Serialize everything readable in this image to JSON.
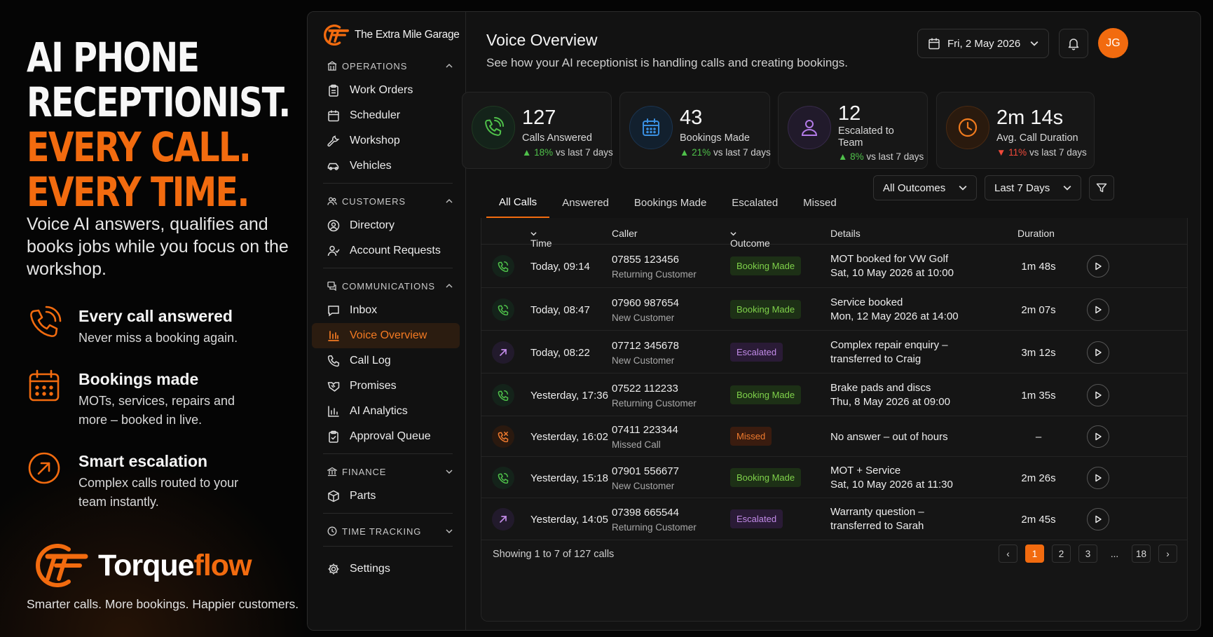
{
  "promo": {
    "headline": [
      "AI PHONE",
      "RECEPTIONIST.",
      "EVERY CALL.",
      "EVERY TIME."
    ],
    "subtitle": "Voice AI answers, qualifies and books jobs while you focus on the workshop.",
    "features": [
      {
        "icon": "phone-ringing-icon",
        "title": "Every call answered",
        "desc": "Never miss a booking again."
      },
      {
        "icon": "calendar-icon",
        "title": "Bookings made",
        "desc": "MOTs, services, repairs and more – booked in live."
      },
      {
        "icon": "arrow-up-right-circle-icon",
        "title": "Smart escalation",
        "desc": "Complex calls routed to your team instantly."
      }
    ],
    "brand_part1": "Torque",
    "brand_part2": "flow",
    "tagline": "Smarter calls. More bookings. Happier customers."
  },
  "app": {
    "garage_name": "The Extra Mile Garage",
    "sections": {
      "operations": "OPERATIONS",
      "customers": "CUSTOMERS",
      "communications": "COMMUNICATIONS",
      "finance": "FINANCE",
      "time_tracking": "TIME TRACKING"
    },
    "nav": {
      "work_orders": "Work Orders",
      "scheduler": "Scheduler",
      "workshop": "Workshop",
      "vehicles": "Vehicles",
      "directory": "Directory",
      "account_requests": "Account Requests",
      "inbox": "Inbox",
      "voice_overview": "Voice Overview",
      "call_log": "Call Log",
      "promises": "Promises",
      "ai_analytics": "AI Analytics",
      "approval_queue": "Approval Queue",
      "parts": "Parts",
      "settings": "Settings"
    },
    "header": {
      "title": "Voice Overview",
      "subtitle": "See how your AI receptionist is handling calls and creating bookings.",
      "date": "Fri, 2 May 2026",
      "avatar_initials": "JG"
    },
    "stats": [
      {
        "value": "127",
        "label": "Calls Answered",
        "trend": "18%",
        "trend_dir": "up",
        "trend_suffix": "vs last 7 days",
        "color": "#4fc14a"
      },
      {
        "value": "43",
        "label": "Bookings Made",
        "trend": "21%",
        "trend_dir": "up",
        "trend_suffix": "vs last 7 days",
        "color": "#3a8fe0"
      },
      {
        "value": "12",
        "label": "Escalated to Team",
        "trend": "8%",
        "trend_dir": "up",
        "trend_suffix": "vs last 7 days",
        "color": "#b37be8"
      },
      {
        "value": "2m 14s",
        "label": "Avg. Call Duration",
        "trend": "11%",
        "trend_dir": "down",
        "trend_suffix": "vs last 7 days",
        "color": "#f07b1e"
      }
    ],
    "tabs": [
      "All Calls",
      "Answered",
      "Bookings Made",
      "Escalated",
      "Missed"
    ],
    "filters": {
      "outcome": "All Outcomes",
      "range": "Last 7 Days"
    },
    "table": {
      "headers": {
        "time": "Time",
        "caller": "Caller",
        "outcome": "Outcome",
        "details": "Details",
        "duration": "Duration"
      },
      "rows": [
        {
          "type": "answered",
          "time": "Today, 09:14",
          "number": "07855 123456",
          "caller_type": "Returning Customer",
          "outcome": "Booking Made",
          "d1": "MOT booked for VW Golf",
          "d2": "Sat, 10 May 2026 at 10:00",
          "duration": "1m 48s"
        },
        {
          "type": "answered",
          "time": "Today, 08:47",
          "number": "07960 987654",
          "caller_type": "New Customer",
          "outcome": "Booking Made",
          "d1": "Service booked",
          "d2": "Mon, 12 May 2026 at 14:00",
          "duration": "2m 07s"
        },
        {
          "type": "escalated",
          "time": "Today, 08:22",
          "number": "07712 345678",
          "caller_type": "New Customer",
          "outcome": "Escalated",
          "d1": "Complex repair enquiry –",
          "d2": "transferred to Craig",
          "duration": "3m 12s"
        },
        {
          "type": "answered",
          "time": "Yesterday, 17:36",
          "number": "07522 112233",
          "caller_type": "Returning Customer",
          "outcome": "Booking Made",
          "d1": "Brake pads and discs",
          "d2": "Thu, 8 May 2026 at 09:00",
          "duration": "1m 35s"
        },
        {
          "type": "missed",
          "time": "Yesterday, 16:02",
          "number": "07411 223344",
          "caller_type": "Missed Call",
          "outcome": "Missed",
          "d1": "No answer – out of hours",
          "d2": "",
          "duration": "–"
        },
        {
          "type": "answered",
          "time": "Yesterday, 15:18",
          "number": "07901 556677",
          "caller_type": "New Customer",
          "outcome": "Booking Made",
          "d1": "MOT + Service",
          "d2": "Sat, 10 May 2026 at 11:30",
          "duration": "2m 26s"
        },
        {
          "type": "escalated",
          "time": "Yesterday, 14:05",
          "number": "07398 665544",
          "caller_type": "Returning Customer",
          "outcome": "Escalated",
          "d1": "Warranty question –",
          "d2": "transferred to Sarah",
          "duration": "2m 45s"
        }
      ]
    },
    "footer": {
      "showing": "Showing 1 to 7 of 127 calls",
      "pages": [
        "1",
        "2",
        "3",
        "...",
        "18"
      ],
      "prev": "‹",
      "next": "›"
    },
    "colors": {
      "accent": "#f26b0f",
      "success": "#4fc14a",
      "escalated": "#b37be8",
      "missed": "#f07b2e"
    }
  }
}
